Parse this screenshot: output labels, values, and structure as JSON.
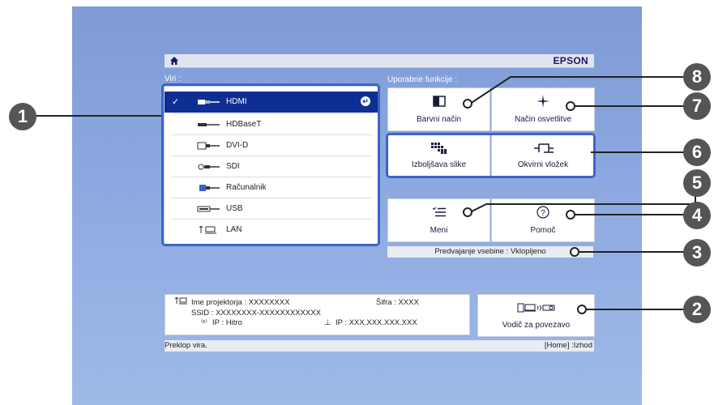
{
  "header": {
    "brand": "EPSON"
  },
  "sources": {
    "heading": "Viri :",
    "items": [
      {
        "label": "HDMI",
        "icon": "hdmi-port-icon",
        "selected": true
      },
      {
        "label": "HDBaseT",
        "icon": "hdbaset-port-icon"
      },
      {
        "label": "DVI-D",
        "icon": "dvi-port-icon"
      },
      {
        "label": "SDI",
        "icon": "sdi-port-icon"
      },
      {
        "label": "Računalnik",
        "icon": "computer-port-icon"
      },
      {
        "label": "USB",
        "icon": "usb-port-icon"
      },
      {
        "label": "LAN",
        "icon": "lan-port-icon"
      }
    ]
  },
  "functions": {
    "heading": "Uporabne funkcije :",
    "color_mode": "Barvni način",
    "light_mode": "Način osvetlitve",
    "image_enhance": "Izboljšava slike",
    "frame_overlay": "Okvirni vložek",
    "menu": "Meni",
    "help": "Pomoč"
  },
  "status": {
    "content_playback": "Predvajanje vsebine : Vklopljeno"
  },
  "network": {
    "projector_name": "Ime projektorja : XXXXXXXX",
    "password": "Šifra : XXXX",
    "ssid": "SSID : XXXXXXXX-XXXXXXXXXXXX",
    "ip_mode": "IP : Hitro",
    "ip_address": "IP : XXX.XXX.XXX.XXX"
  },
  "connection_guide": {
    "label": "Vodič za povezavo"
  },
  "footer": {
    "left": "Preklop vira.",
    "right": "[Home] :Izhod"
  },
  "callouts": [
    "1",
    "2",
    "3",
    "4",
    "5",
    "6",
    "7",
    "8"
  ],
  "colors": {
    "selection": "#0f2e94",
    "highlight_border": "#3d63c9",
    "screen_bg": "#8ba7df",
    "callout": "#555555"
  }
}
